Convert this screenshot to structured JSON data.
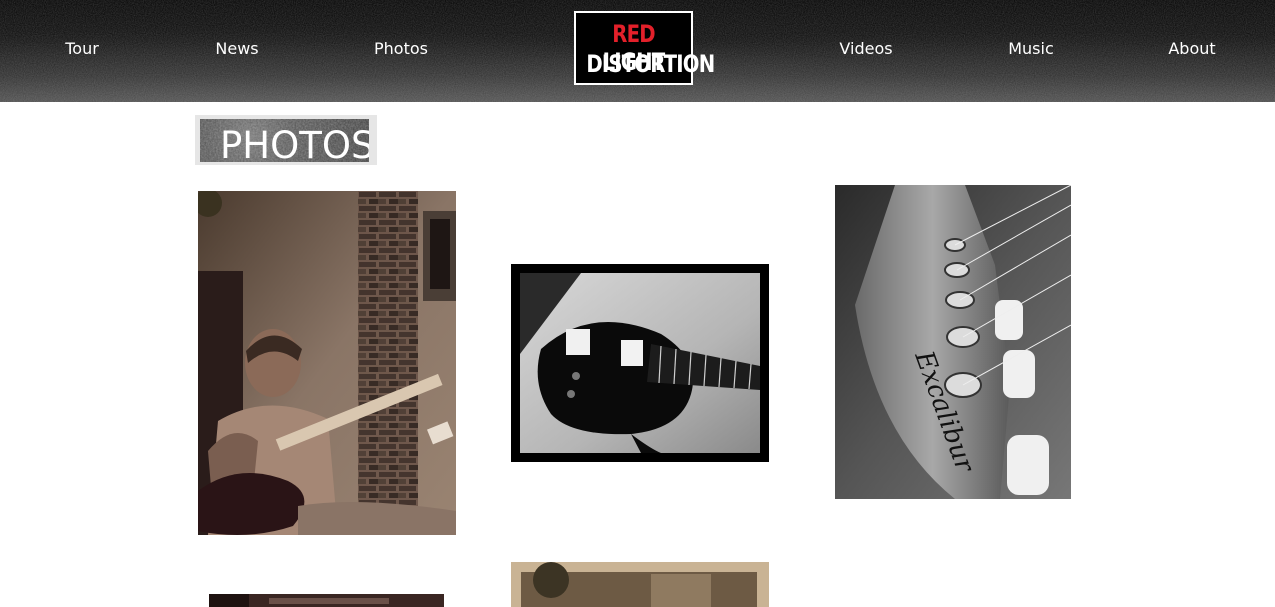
{
  "nav": {
    "left": [
      {
        "label": "Tour"
      },
      {
        "label": "News"
      },
      {
        "label": "Photos"
      }
    ],
    "right": [
      {
        "label": "Videos"
      },
      {
        "label": "Music"
      },
      {
        "label": "About"
      }
    ]
  },
  "logo": {
    "word1": "RED",
    "word2": "LIGHT",
    "word3": "DISTORTION",
    "accent_color": "#e3202a"
  },
  "section": {
    "title": "PHOTOS"
  },
  "photos": [
    {
      "subject": "guitarist-sepia"
    },
    {
      "subject": "guitar-black-white"
    },
    {
      "subject": "headstock-excalibur"
    },
    {
      "subject": "guitar-dark"
    },
    {
      "subject": "building-sepia"
    }
  ],
  "headstock_text": "Excalibur",
  "colors": {
    "header_bg": "#111111",
    "page_bg": "#ffffff",
    "nav_text": "#ffffff"
  }
}
